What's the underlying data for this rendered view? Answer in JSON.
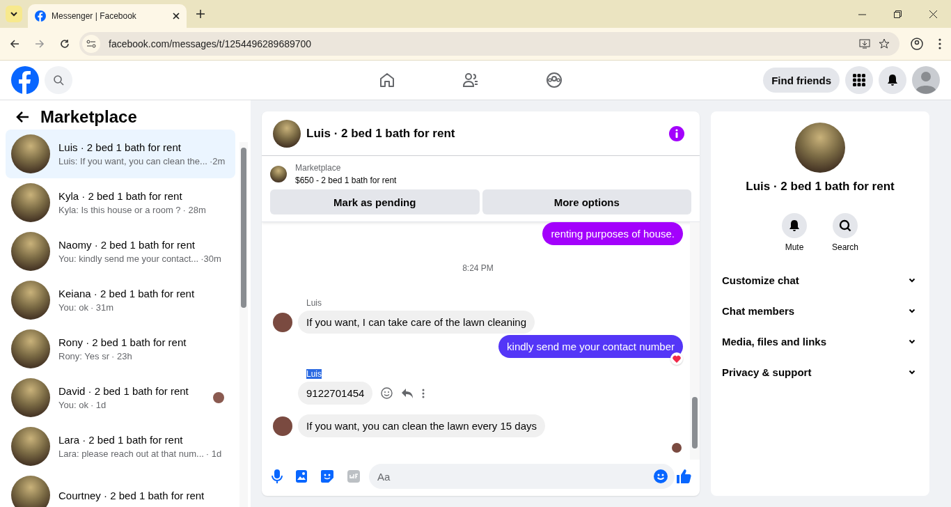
{
  "browser": {
    "tab_title": "Messenger | Facebook",
    "url": "facebook.com/messages/t/1254496289689700"
  },
  "top_nav": {
    "find_friends": "Find friends"
  },
  "sidebar": {
    "title": "Marketplace",
    "conversations": [
      {
        "name": "Luis · 2 bed 1 bath for rent",
        "preview": "Luis: If you want, you can clean the...",
        "time": "·2m",
        "selected": true,
        "seen": false
      },
      {
        "name": "Kyla · 2 bed 1 bath for rent",
        "preview": "Kyla: Is this house or a room ?",
        "time": "· 28m",
        "selected": false,
        "seen": false
      },
      {
        "name": "Naomy · 2 bed 1 bath for rent",
        "preview": "You: kindly send me your contact...",
        "time": "·30m",
        "selected": false,
        "seen": false
      },
      {
        "name": "Keiana · 2 bed 1 bath for rent",
        "preview": "You: ok",
        "time": "· 31m",
        "selected": false,
        "seen": false
      },
      {
        "name": "Rony · 2 bed 1 bath for rent",
        "preview": "Rony: Yes sr",
        "time": "· 23h",
        "selected": false,
        "seen": false
      },
      {
        "name": "David · 2 bed 1 bath for rent",
        "preview": "You: ok",
        "time": "· 1d",
        "selected": false,
        "seen": true
      },
      {
        "name": "Lara · 2 bed 1 bath for rent",
        "preview": "Lara: please reach out at that num...",
        "time": "· 1d",
        "selected": false,
        "seen": false
      },
      {
        "name": "Courtney · 2 bed 1 bath for rent",
        "selected": false,
        "seen": false
      }
    ]
  },
  "chat": {
    "title": "Luis · 2 bed 1 bath for rent",
    "listing": {
      "source": "Marketplace",
      "item": "$650 - 2 bed 1 bath for rent",
      "buttons": [
        "Mark as pending",
        "More options"
      ]
    },
    "messages": [
      {
        "kind": "out",
        "text": "renting purposes of house.",
        "color": "#a301fc",
        "reaction": false
      },
      {
        "kind": "time",
        "text": "8:24 PM"
      },
      {
        "kind": "in",
        "sender": "Luis",
        "sender_highlighted": false,
        "text": "If you want, I can take care of the lawn cleaning",
        "avatar": true,
        "hover_actions": false
      },
      {
        "kind": "out",
        "text": "kindly send me your contact number",
        "color": "#5436f7",
        "reaction": true
      },
      {
        "kind": "in",
        "sender": "Luis",
        "sender_highlighted": true,
        "text": "9122701454",
        "avatar": false,
        "hover_actions": true
      },
      {
        "kind": "in",
        "text": "If you want, you can clean the lawn every 15 days",
        "avatar": true,
        "hover_actions": false
      }
    ],
    "composer": {
      "placeholder": "Aa"
    }
  },
  "details": {
    "title": "Luis · 2 bed 1 bath for rent",
    "actions": [
      {
        "kind": "mute",
        "label": "Mute"
      },
      {
        "kind": "search",
        "label": "Search"
      }
    ],
    "sections": [
      "Customize chat",
      "Chat members",
      "Media, files and links",
      "Privacy & support"
    ]
  }
}
